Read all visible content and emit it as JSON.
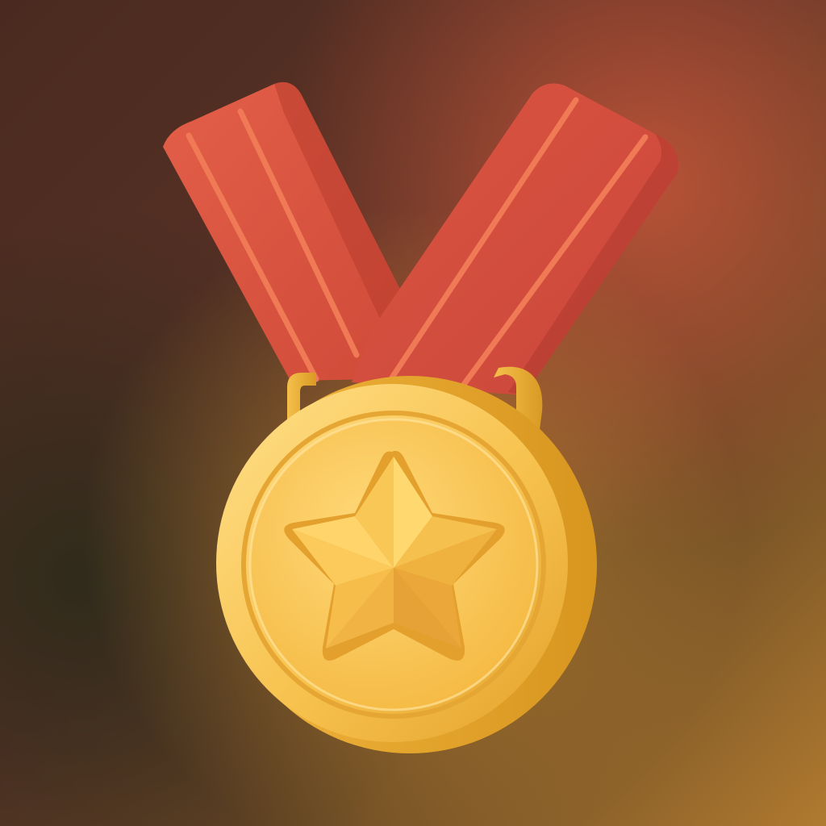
{
  "image": {
    "subject": "medal-icon",
    "icons": [
      "medal-icon",
      "ribbon-left",
      "ribbon-right",
      "medal-loop",
      "medal-disc",
      "star-icon"
    ],
    "colors": {
      "background_top_left": "#4a2a20",
      "background_top_right": "#c45a3a",
      "background_bottom_left": "#2e2a1c",
      "background_bottom_right": "#b07a30",
      "ribbon": "#d9533f",
      "ribbon_shadow": "#b83c2e",
      "ribbon_stripe": "#f07a55",
      "gold_light": "#ffd777",
      "gold": "#f6c04e",
      "gold_dark": "#d99a22",
      "star": "#f7c244"
    }
  }
}
